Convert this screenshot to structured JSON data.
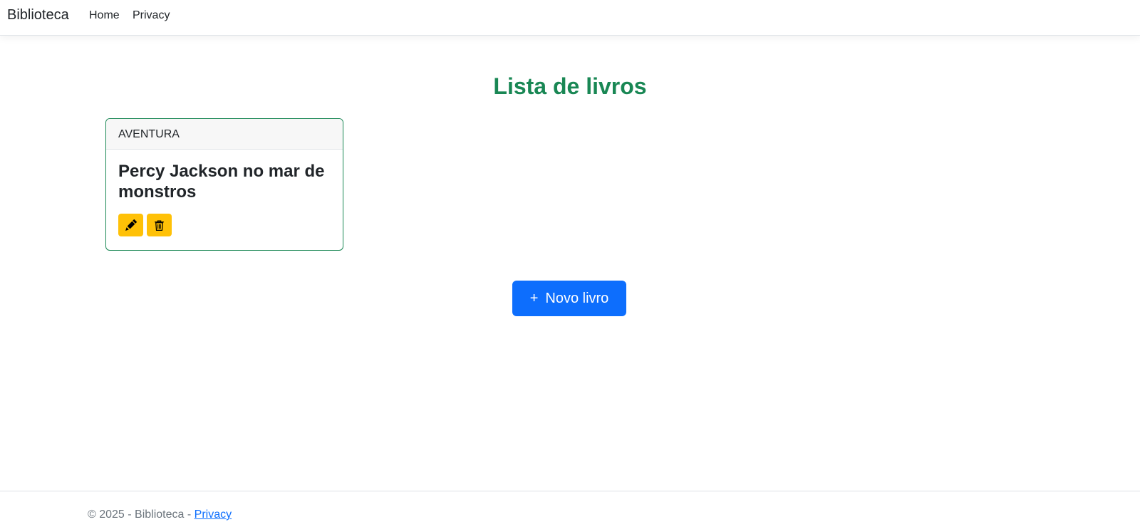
{
  "navbar": {
    "brand": "Biblioteca",
    "links": [
      {
        "label": "Home"
      },
      {
        "label": "Privacy"
      }
    ]
  },
  "main": {
    "title": "Lista de livros",
    "books": [
      {
        "category": "AVENTURA",
        "title": "Percy Jackson no mar de monstros",
        "actions": [
          {
            "icon": "pencil-icon"
          },
          {
            "icon": "trash-icon"
          }
        ]
      }
    ],
    "new_button": {
      "icon": "plus-icon",
      "icon_glyph": "+",
      "label": "Novo livro"
    }
  },
  "footer": {
    "text": "© 2025 - Biblioteca - ",
    "link_label": "Privacy"
  },
  "colors": {
    "title_green": "#198754",
    "primary_blue": "#0d6efd",
    "warning_yellow": "#ffc107"
  }
}
